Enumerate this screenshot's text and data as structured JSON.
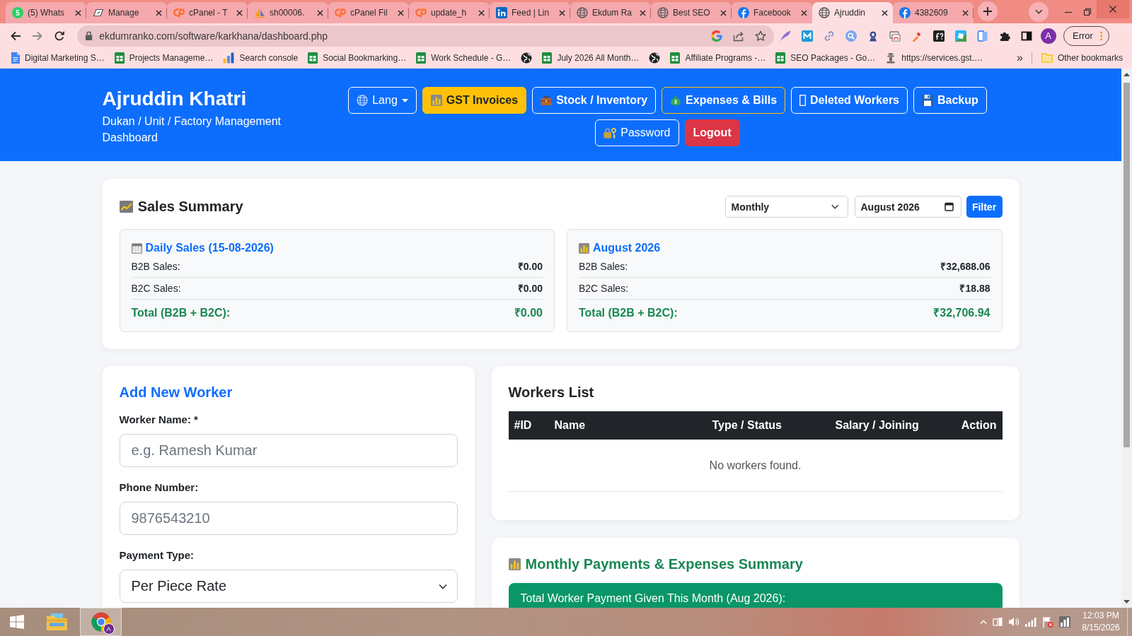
{
  "browser": {
    "tabs": [
      {
        "title": "(5) Whats",
        "badge": "5",
        "selected": false
      },
      {
        "title": "Manage",
        "selected": false
      },
      {
        "title": "cPanel - T",
        "selected": false
      },
      {
        "title": "sh00006.",
        "selected": false
      },
      {
        "title": "cPanel Fil",
        "selected": false
      },
      {
        "title": "update_h",
        "selected": false
      },
      {
        "title": "Feed | Lin",
        "selected": false
      },
      {
        "title": "Ekdum Ra",
        "selected": false
      },
      {
        "title": "Best SEO",
        "selected": false
      },
      {
        "title": "Facebook",
        "selected": false
      },
      {
        "title": "Ajruddin",
        "selected": true
      },
      {
        "title": "4382609",
        "selected": false
      }
    ],
    "address_bar": {
      "url": "ekdumranko.com/software/karkhana/dashboard.php"
    },
    "profile_initial": "A",
    "status_button": "Error",
    "bookmarks": [
      {
        "kind": "titled",
        "title": "Digital Marketing S…"
      },
      {
        "kind": "titled",
        "title": "Projects Manageme…"
      },
      {
        "kind": "titled",
        "title": "Search console"
      },
      {
        "kind": "titled",
        "title": "Social Bookmarking…"
      },
      {
        "kind": "titled",
        "title": "Work Schedule - G…"
      },
      {
        "kind": "icon"
      },
      {
        "kind": "titled",
        "title": "July 2026 All Month…"
      },
      {
        "kind": "icon"
      },
      {
        "kind": "titled",
        "title": "Affiliate Programs -…"
      },
      {
        "kind": "titled",
        "title": "SEO Packages - Go…"
      },
      {
        "kind": "titled",
        "title": "https://services.gst.…"
      }
    ],
    "bookmarks_overflow": "»",
    "other_bookmarks": "Other bookmarks"
  },
  "header": {
    "title": "Ajruddin Khatri",
    "subtitle": "Dukan / Unit / Factory Management Dashboard",
    "button_rows": [
      [
        {
          "label": "Lang",
          "kind": "dropdown"
        },
        {
          "label": "GST Invoices",
          "kind": "highlight"
        },
        {
          "label": "Stock / Inventory",
          "kind": "link"
        },
        {
          "label": "Expenses & Bills",
          "kind": "accent"
        },
        {
          "label": "Deleted Workers",
          "kind": "link"
        },
        {
          "label": "Backup",
          "kind": "link"
        }
      ],
      [
        {
          "label": "Password",
          "kind": "modal"
        },
        {
          "label": "Logout",
          "kind": "danger"
        }
      ]
    ]
  },
  "sales_summary": {
    "title": "Sales Summary",
    "period": "Monthly",
    "month": "August 2026",
    "filter_button": "Filter",
    "panels": [
      {
        "title": "Daily Sales (15-08-2026)",
        "rows": [
          {
            "label": "B2B Sales:",
            "value": "₹0.00"
          },
          {
            "label": "B2C Sales:",
            "value": "₹0.00"
          }
        ],
        "total": {
          "label": "Total (B2B + B2C):",
          "value": "₹0.00"
        }
      },
      {
        "title": "August 2026",
        "rows": [
          {
            "label": "B2B Sales:",
            "value": "₹32,688.06"
          },
          {
            "label": "B2C Sales:",
            "value": "₹18.88"
          }
        ],
        "total": {
          "label": "Total (B2B + B2C):",
          "value": "₹32,706.94"
        }
      }
    ]
  },
  "add_worker": {
    "title": "Add New Worker",
    "fields": [
      {
        "label": "Worker Name: *",
        "kind": "text",
        "placeholder": "e.g. Ramesh Kumar"
      },
      {
        "label": "Phone Number:",
        "kind": "text",
        "placeholder": "9876543210"
      },
      {
        "label": "Payment Type:",
        "kind": "select",
        "value": "Per Piece Rate"
      }
    ]
  },
  "workers_list": {
    "title": "Workers List",
    "columns": [
      "#ID",
      "Name",
      "Type / Status",
      "Salary / Joining",
      "Action"
    ],
    "empty_message": "No workers found."
  },
  "monthly_summary": {
    "title": "Monthly Payments & Expenses Summary",
    "banner": "Total Worker Payment Given This Month (Aug 2026):"
  },
  "taskbar": {
    "apps": [
      {
        "selected": false
      },
      {
        "badge": "A",
        "selected": true
      }
    ],
    "clock": {
      "time": "12:03 PM",
      "date": "8/15/2026"
    }
  }
}
